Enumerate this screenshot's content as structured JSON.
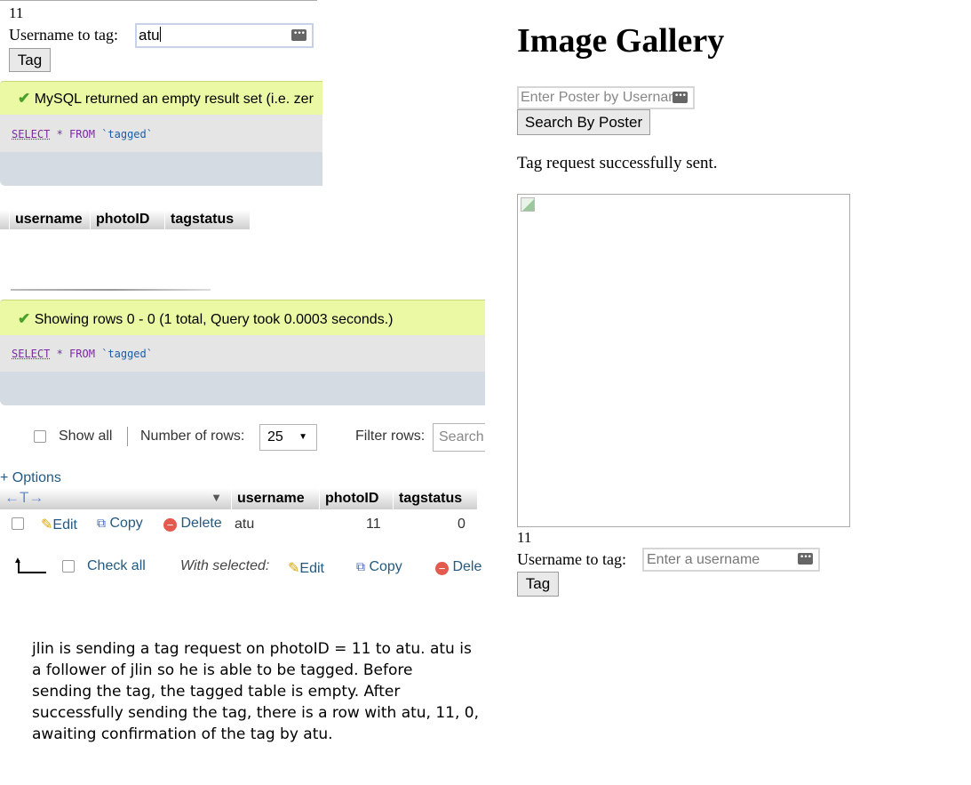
{
  "left": {
    "top_number": "11",
    "username_label": "Username to tag:",
    "username_value": "atu",
    "tag_button": "Tag",
    "msg1": "MySQL returned an empty result set (i.e. zer",
    "sql_kw_select": "SELECT",
    "sql_star_from": "* FROM",
    "sql_table": "`tagged`",
    "table1_headers": [
      "username",
      "photoID",
      "tagstatus"
    ],
    "msg2": "Showing rows 0 - 0 (1 total, Query took 0.0003 seconds.)",
    "show_all": "Show all",
    "number_of_rows_label": "Number of rows:",
    "rows_select_value": "25",
    "filter_rows_label": "Filter rows:",
    "filter_placeholder": "Search",
    "options_link": "+ Options",
    "col_arrows": "←T→",
    "table2_headers": [
      "username",
      "photoID",
      "tagstatus"
    ],
    "row": {
      "edit": "Edit",
      "copy": "Copy",
      "delete": "Delete",
      "username": "atu",
      "photoID": "11",
      "tagstatus": "0"
    },
    "check_all": "Check all",
    "with_selected": "With selected:",
    "bottom_edit": "Edit",
    "bottom_copy": "Copy",
    "bottom_delete": "Dele",
    "caption": [
      "jlin is sending a tag request on photoID = 11 to atu. atu is",
      "a follower of jlin so he is able to be tagged. Before",
      "sending the tag, the tagged table is empty. After",
      "successfully sending the tag, there is a row with atu, 11, 0,",
      "awaiting confirmation of the tag by atu."
    ]
  },
  "right": {
    "title": "Image Gallery",
    "search_placeholder": "Enter Poster by Username",
    "search_button": "Search By Poster",
    "status": "Tag request successfully sent.",
    "photo_number": "11",
    "username_label": "Username to tag:",
    "username_placeholder": "Enter a username",
    "tag_button": "Tag"
  }
}
